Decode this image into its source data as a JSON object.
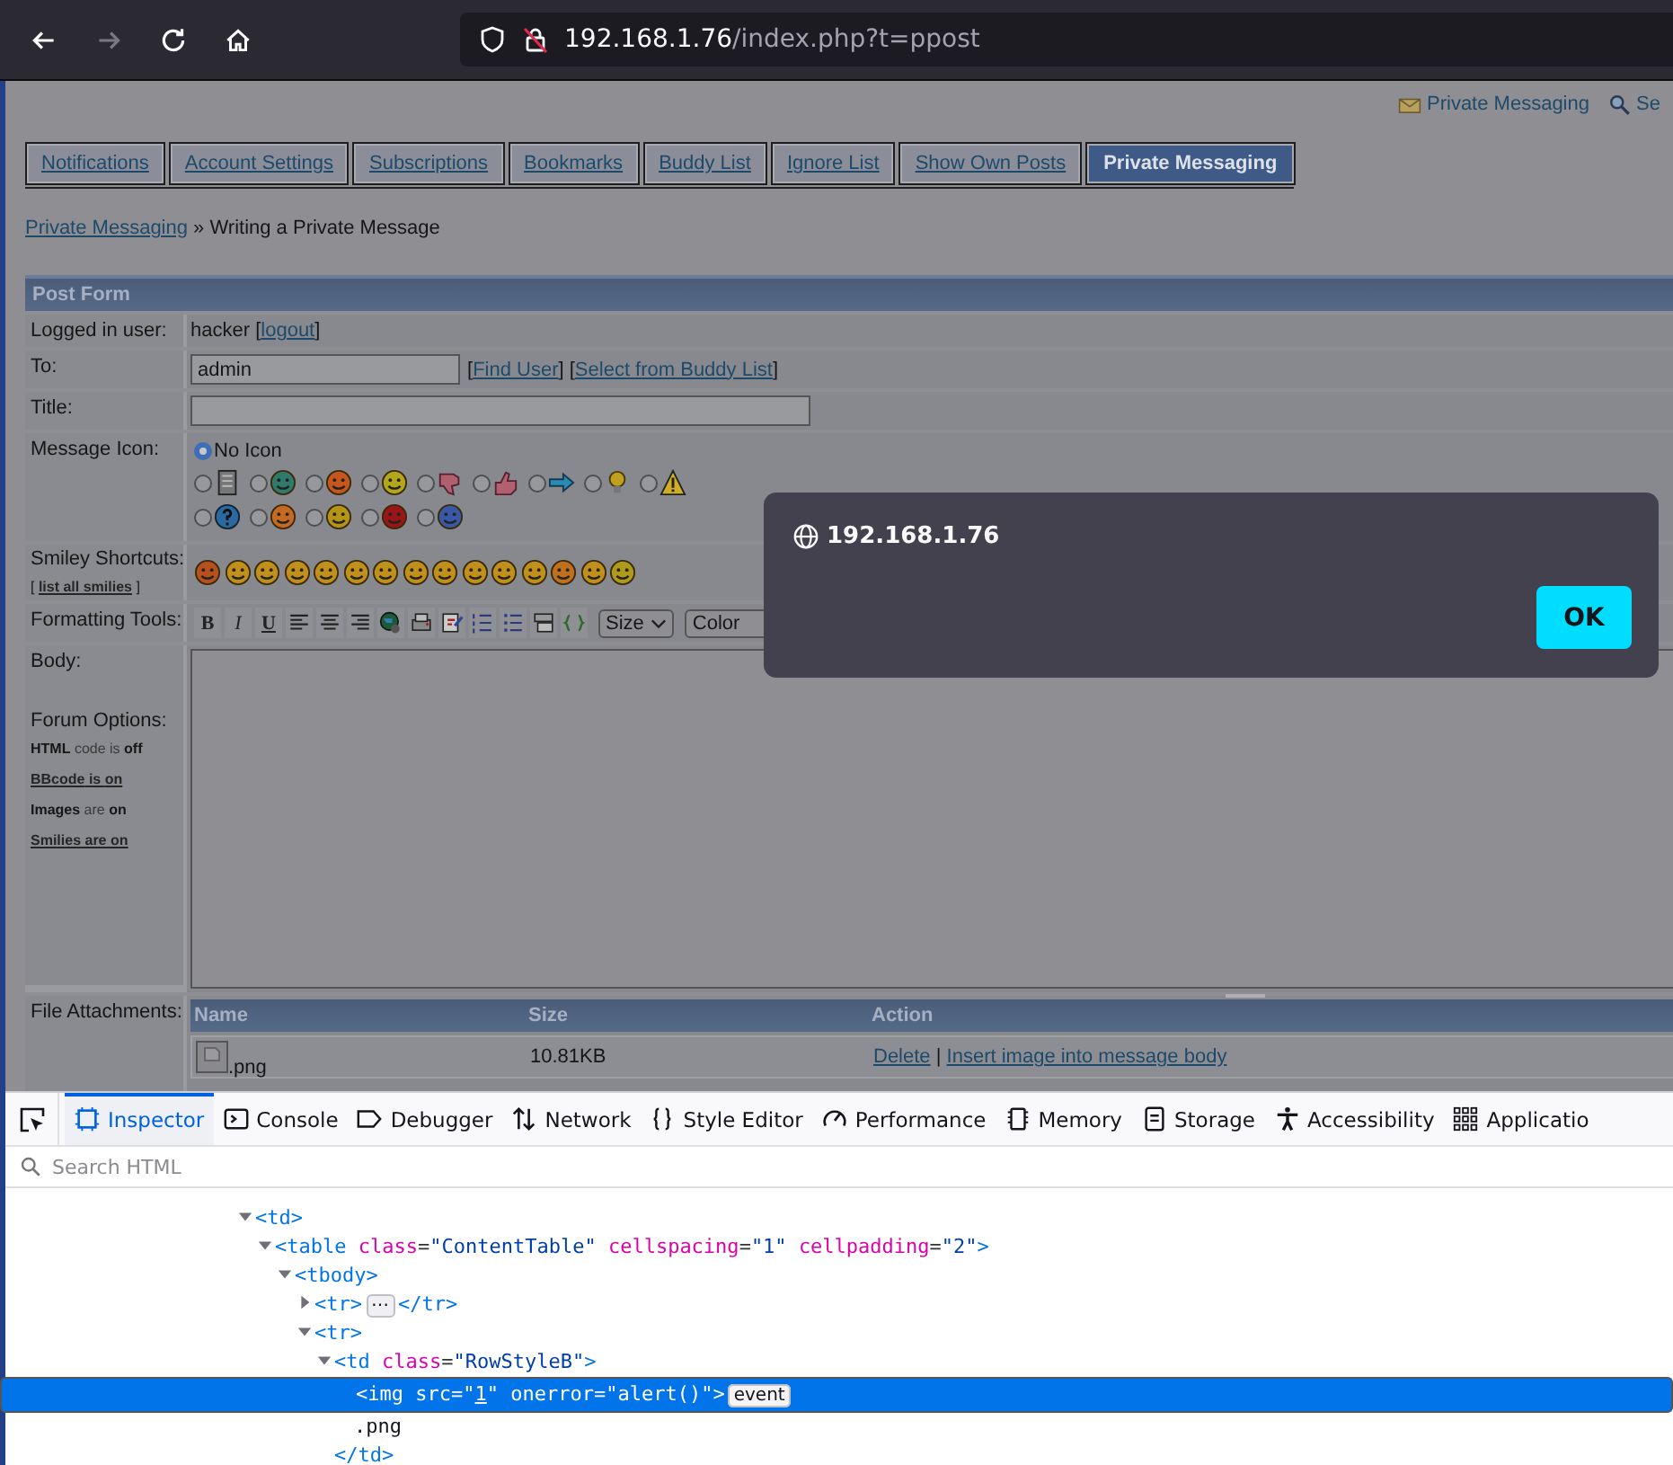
{
  "browser": {
    "nav": [
      {
        "kind": "back",
        "disabled": false
      },
      {
        "kind": "forward",
        "disabled": true
      },
      {
        "kind": "reload",
        "disabled": false
      },
      {
        "kind": "home",
        "disabled": false
      }
    ],
    "url_host": "192.168.1.76",
    "url_path": "/index.php?t=ppost"
  },
  "top_links": [
    {
      "kind": "envelope",
      "label": "Private Messaging"
    },
    {
      "kind": "search-people",
      "label": "Se"
    }
  ],
  "tabs": [
    {
      "label": "Notifications",
      "selected": false
    },
    {
      "label": "Account Settings",
      "selected": false
    },
    {
      "label": "Subscriptions",
      "selected": false
    },
    {
      "label": "Bookmarks",
      "selected": false
    },
    {
      "label": "Buddy List",
      "selected": false
    },
    {
      "label": "Ignore List",
      "selected": false
    },
    {
      "label": "Show Own Posts",
      "selected": false
    },
    {
      "label": "Private Messaging",
      "selected": true
    }
  ],
  "breadcrumb": {
    "link": "Private Messaging",
    "current": " » Writing a Private Message"
  },
  "form": {
    "title": "Post Form",
    "logged_in": {
      "label": "Logged in user:",
      "parts": [
        {
          "s": "hacker [",
          "link": false
        },
        {
          "s": "logout",
          "link": true
        },
        {
          "s": "]",
          "link": false
        }
      ]
    },
    "to": {
      "label": "To:",
      "value": "admin",
      "parts": [
        {
          "s": "[",
          "link": false
        },
        {
          "s": "Find User",
          "link": true
        },
        {
          "s": "] [",
          "link": false
        },
        {
          "s": "Select from Buddy List",
          "link": true
        },
        {
          "s": "]",
          "link": false
        }
      ]
    },
    "title_field": {
      "label": "Title:"
    },
    "message_icon": {
      "label": "Message Icon:",
      "rows": [
        [
          {
            "kind": "none",
            "label": "No Icon",
            "selected": true
          }
        ],
        [
          {
            "kind": "document",
            "selected": false
          },
          {
            "kind": "face",
            "color": "#2f7a6a",
            "selected": false
          },
          {
            "kind": "face",
            "color": "#c4561e",
            "selected": false
          },
          {
            "kind": "face",
            "color": "#b3a51c",
            "selected": false
          },
          {
            "kind": "thumb-down",
            "selected": false
          },
          {
            "kind": "thumb-up",
            "selected": false
          },
          {
            "kind": "arrow",
            "selected": false
          },
          {
            "kind": "bulb",
            "selected": false
          },
          {
            "kind": "warning",
            "selected": false
          }
        ],
        [
          {
            "kind": "question",
            "selected": false
          },
          {
            "kind": "face",
            "color": "#c66a22",
            "selected": false
          },
          {
            "kind": "face",
            "color": "#b39418",
            "selected": false
          },
          {
            "kind": "face",
            "color": "#9a1616",
            "selected": false
          },
          {
            "kind": "face",
            "color": "#3a58a8",
            "selected": false
          }
        ]
      ]
    },
    "smileys": {
      "label": "Smiley Shortcuts:",
      "list_parts": [
        {
          "s": "[ ",
          "link": false
        },
        {
          "s": "list all smilies",
          "link": true
        },
        {
          "s": " ]",
          "link": false
        }
      ],
      "items": [
        {
          "color": "#b8501e"
        },
        {
          "color": "#c0901a"
        },
        {
          "color": "#c0901a"
        },
        {
          "color": "#c0901a"
        },
        {
          "color": "#c0901a"
        },
        {
          "color": "#c0901a"
        },
        {
          "color": "#c0901a"
        },
        {
          "color": "#c0901a"
        },
        {
          "color": "#c0901a"
        },
        {
          "color": "#c0901a"
        },
        {
          "color": "#c0901a"
        },
        {
          "color": "#c0901a"
        },
        {
          "color": "#c0701a"
        },
        {
          "color": "#c0901a"
        },
        {
          "color": "#b09a1a"
        }
      ]
    },
    "formatting": {
      "label": "Formatting Tools:",
      "tools": [
        {
          "kind": "bold",
          "label": "B"
        },
        {
          "kind": "italic",
          "label": "I"
        },
        {
          "kind": "underline",
          "label": "U"
        },
        {
          "kind": "align-left"
        },
        {
          "kind": "align-center"
        },
        {
          "kind": "align-right"
        },
        {
          "kind": "globe"
        },
        {
          "kind": "image"
        },
        {
          "kind": "edit"
        },
        {
          "kind": "list-ordered"
        },
        {
          "kind": "list-bullet"
        },
        {
          "kind": "quote"
        },
        {
          "kind": "code"
        }
      ],
      "selects": [
        "Size",
        "Color"
      ]
    },
    "body": {
      "label": "Body:"
    },
    "forum_options": {
      "label": "Forum Options:",
      "items": [
        {
          "text": "**HTML** code is **off**",
          "link": false
        },
        {
          "text": "**BBcode** is **on**",
          "link": true
        },
        {
          "text": "**Images** are **on**",
          "link": false
        },
        {
          "text": "**Smilies** are **on**",
          "link": true
        }
      ]
    },
    "attachments": {
      "label": "File Attachments:",
      "columns": [
        "Name",
        "Size",
        "Action"
      ],
      "rows": [
        {
          "name": ".png",
          "size": "10.81KB",
          "actions": [
            {
              "s": "Delete",
              "link": true
            },
            {
              "s": " | ",
              "link": false
            },
            {
              "s": "Insert image into message body",
              "link": true
            }
          ]
        }
      ]
    }
  },
  "dialog": {
    "host": "192.168.1.76",
    "button": "OK"
  },
  "devtools": {
    "tabs": [
      {
        "kind": "inspector",
        "label": "Inspector",
        "selected": true
      },
      {
        "kind": "console",
        "label": "Console",
        "selected": false
      },
      {
        "kind": "debugger",
        "label": "Debugger",
        "selected": false
      },
      {
        "kind": "network",
        "label": "Network",
        "selected": false
      },
      {
        "kind": "style",
        "label": "Style Editor",
        "selected": false
      },
      {
        "kind": "performance",
        "label": "Performance",
        "selected": false
      },
      {
        "kind": "memory",
        "label": "Memory",
        "selected": false
      },
      {
        "kind": "storage",
        "label": "Storage",
        "selected": false
      },
      {
        "kind": "accessibility",
        "label": "Accessibility",
        "selected": false
      },
      {
        "kind": "application",
        "label": "Applicatio",
        "selected": false
      }
    ],
    "search": {
      "placeholder": "Search HTML"
    },
    "tree": [
      {
        "expanded": true,
        "selected": false,
        "tokens": [
          {
            "kind": "tag",
            "s": "<td>"
          }
        ],
        "children": [
          {
            "expanded": true,
            "selected": false,
            "tokens": [
              {
                "kind": "tag",
                "s": "<table "
              },
              {
                "kind": "attr",
                "s": "class"
              },
              {
                "kind": "punct",
                "s": "="
              },
              {
                "kind": "value",
                "s": "\"ContentTable\" "
              },
              {
                "kind": "attr",
                "s": "cellspacing"
              },
              {
                "kind": "punct",
                "s": "="
              },
              {
                "kind": "value",
                "s": "\"1\" "
              },
              {
                "kind": "attr",
                "s": "cellpadding"
              },
              {
                "kind": "punct",
                "s": "="
              },
              {
                "kind": "value",
                "s": "\"2\""
              },
              {
                "kind": "tag",
                "s": ">"
              }
            ],
            "children": [
              {
                "expanded": true,
                "selected": false,
                "tokens": [
                  {
                    "kind": "tag",
                    "s": "<tbody>"
                  }
                ],
                "children": [
                  {
                    "expanded": false,
                    "selected": false,
                    "tokens": [
                      {
                        "kind": "tag",
                        "s": "<tr>"
                      },
                      {
                        "kind": "badge",
                        "s": "⋯"
                      },
                      {
                        "kind": "tag",
                        "s": "</tr>"
                      }
                    ]
                  },
                  {
                    "expanded": true,
                    "selected": false,
                    "tokens": [
                      {
                        "kind": "tag",
                        "s": "<tr>"
                      }
                    ],
                    "children": [
                      {
                        "expanded": true,
                        "selected": false,
                        "tokens": [
                          {
                            "kind": "tag",
                            "s": "<td "
                          },
                          {
                            "kind": "attr",
                            "s": "class"
                          },
                          {
                            "kind": "punct",
                            "s": "="
                          },
                          {
                            "kind": "value",
                            "s": "\"RowStyleB\""
                          },
                          {
                            "kind": "tag",
                            "s": ">"
                          }
                        ],
                        "close": [
                          {
                            "kind": "tag",
                            "s": "</td>"
                          }
                        ],
                        "children": [
                          {
                            "selected": true,
                            "tokens": [
                              {
                                "kind": "tag",
                                "s": "<img "
                              },
                              {
                                "kind": "attr",
                                "s": "src"
                              },
                              {
                                "kind": "punct",
                                "s": "="
                              },
                              {
                                "kind": "value",
                                "s": "\""
                              },
                              {
                                "kind": "link",
                                "s": "1"
                              },
                              {
                                "kind": "value",
                                "s": "\" "
                              },
                              {
                                "kind": "attr",
                                "s": "onerror"
                              },
                              {
                                "kind": "punct",
                                "s": "="
                              },
                              {
                                "kind": "value",
                                "s": "\"alert()\""
                              },
                              {
                                "kind": "tag",
                                "s": ">"
                              },
                              {
                                "kind": "badge",
                                "s": "event"
                              }
                            ]
                          },
                          {
                            "selected": false,
                            "tokens": [
                              {
                                "kind": "text",
                                "s": ".png"
                              }
                            ]
                          }
                        ]
                      }
                    ]
                  }
                ]
              }
            ]
          }
        ]
      }
    ]
  }
}
